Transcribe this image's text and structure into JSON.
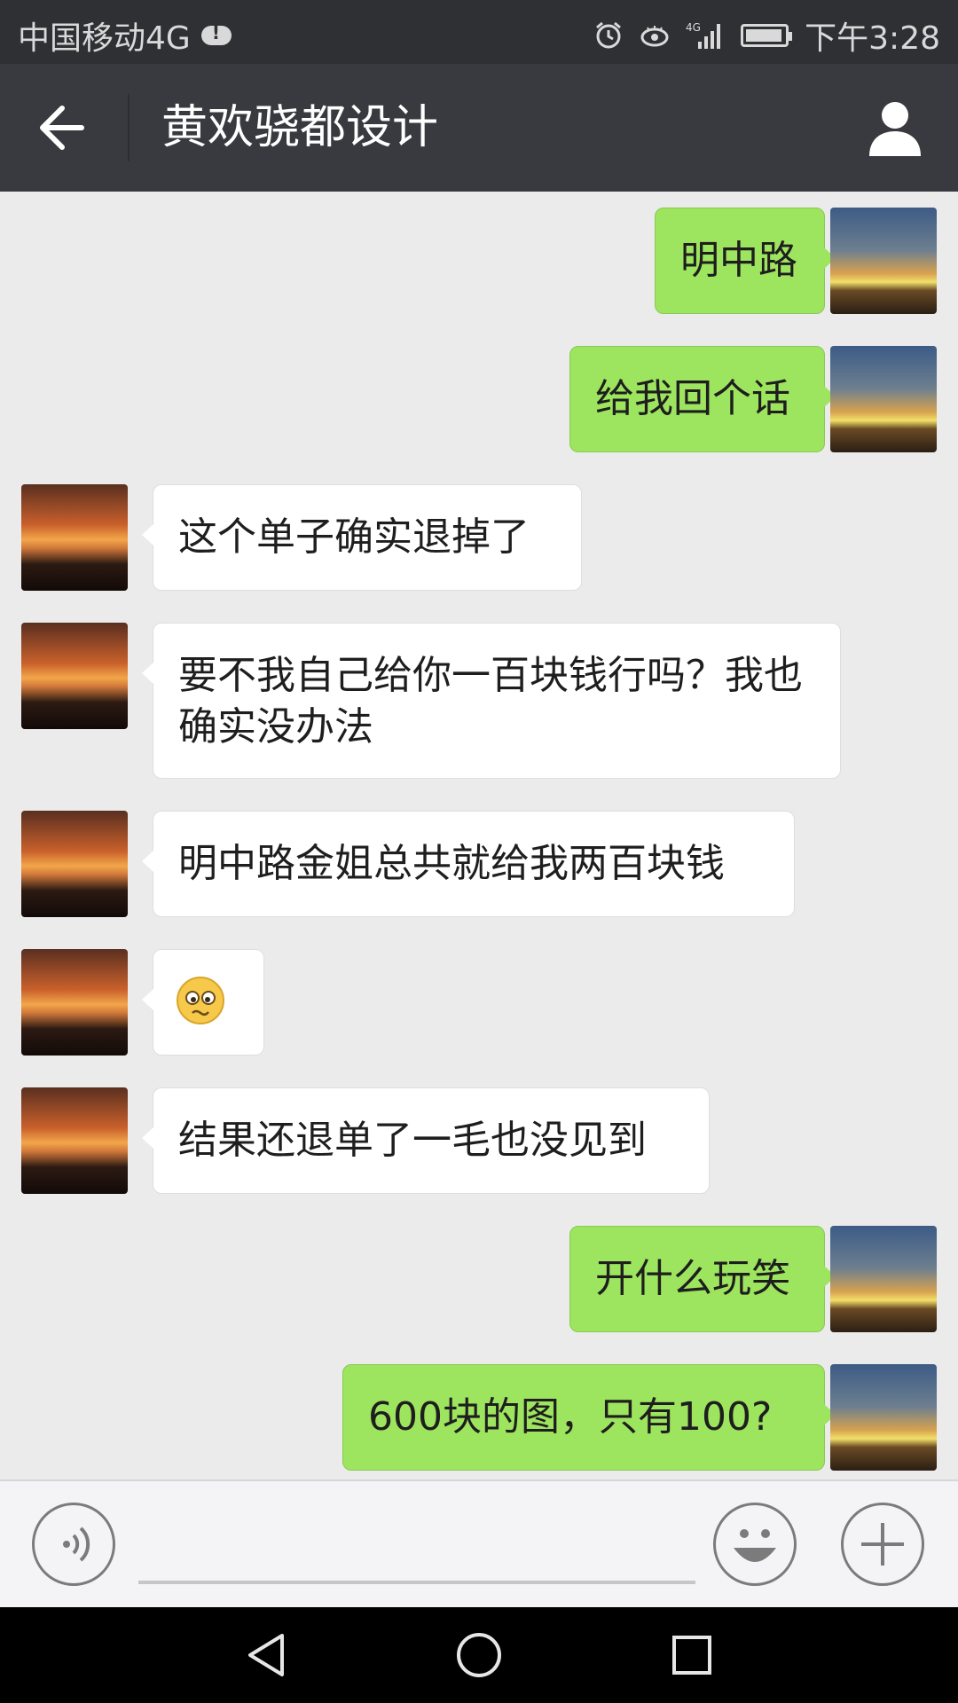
{
  "status_bar": {
    "carrier": "中国移动4G",
    "network_label": "4G",
    "time": "下午3:28",
    "icons": [
      "cloud-alert-icon",
      "alarm-icon",
      "eye-icon",
      "signal-icon",
      "battery-icon"
    ]
  },
  "header": {
    "title": "黄欢骁都设计",
    "back_icon": "back-arrow-icon",
    "contact_icon": "person-icon"
  },
  "messages": [
    {
      "side": "mine",
      "text": "明中路"
    },
    {
      "side": "mine",
      "text": "给我回个话"
    },
    {
      "side": "theirs",
      "text": "这个单子确实退掉了"
    },
    {
      "side": "theirs",
      "text": "要不我自己给你一百块钱行吗？我也确实没办法"
    },
    {
      "side": "theirs",
      "text": "明中路金姐总共就给我两百块钱"
    },
    {
      "side": "theirs",
      "text": "",
      "emoji": "worried-face"
    },
    {
      "side": "theirs",
      "text": "结果还退单了一毛也没见到"
    },
    {
      "side": "mine",
      "text": "开什么玩笑"
    },
    {
      "side": "mine",
      "text": "600块的图，只有100?"
    }
  ],
  "input_bar": {
    "voice_icon": "voice-icon",
    "emoji_icon": "emoji-icon",
    "plus_icon": "plus-icon",
    "input_value": ""
  },
  "nav_bar": {
    "icons": [
      "back-triangle-icon",
      "home-circle-icon",
      "recents-square-icon"
    ]
  },
  "colors": {
    "my_bubble": "#9de45f",
    "their_bubble": "#ffffff",
    "header_bg": "#393a3f",
    "chat_bg": "#ebebeb"
  }
}
